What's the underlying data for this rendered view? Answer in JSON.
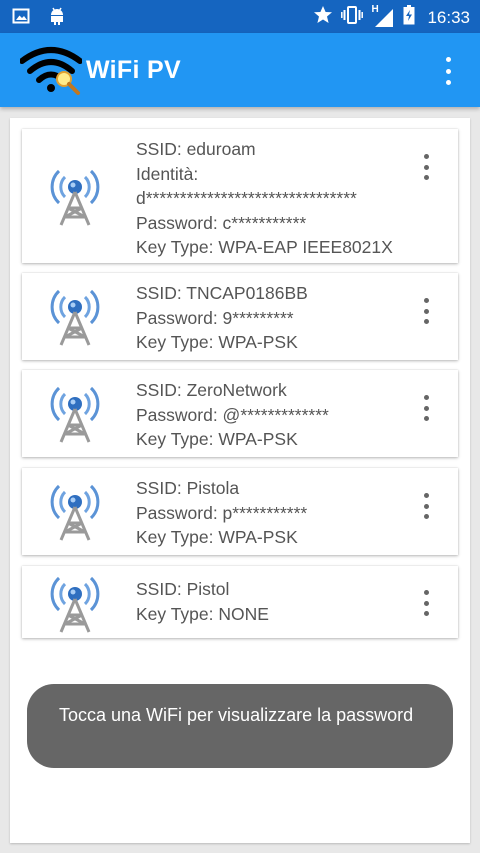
{
  "status_bar": {
    "time": "16:33",
    "network_label": "H",
    "left_icons": [
      "image-icon",
      "android-icon"
    ],
    "right_icons": [
      "star-icon",
      "vibrate-icon",
      "signal-icon",
      "battery-icon"
    ]
  },
  "app_bar": {
    "title": "WiFi PV",
    "logo_icon": "wifi-search-icon",
    "menu_icon": "overflow-menu-icon",
    "color": "#2196f3"
  },
  "networks": [
    {
      "lines": [
        "SSID: eduroam",
        "Identità:",
        "d*******************************",
        "Password: c***********",
        "Key Type: WPA-EAP IEEE8021X"
      ]
    },
    {
      "lines": [
        "SSID: TNCAP0186BB",
        "Password: 9*********",
        "Key Type: WPA-PSK"
      ]
    },
    {
      "lines": [
        "SSID: ZeroNetwork",
        "Password: @*************",
        "Key Type: WPA-PSK"
      ]
    },
    {
      "lines": [
        "SSID: Pistola",
        "Password: p***********",
        "Key Type: WPA-PSK"
      ]
    },
    {
      "lines": [
        "SSID: Pistol",
        "Key Type: NONE"
      ]
    }
  ],
  "toast": {
    "message": "Tocca una WiFi per visualizzare la password"
  }
}
